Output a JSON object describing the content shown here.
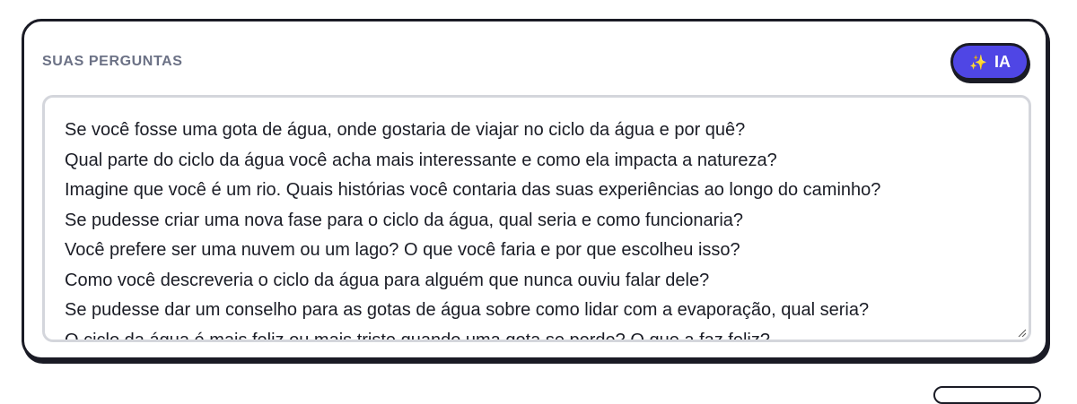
{
  "section": {
    "title": "SUAS PERGUNTAS"
  },
  "ai_button": {
    "icon": "sparkles-icon",
    "label": "IA",
    "color": "#4f46e5"
  },
  "questions": [
    "Se você fosse uma gota de água, onde gostaria de viajar no ciclo da água e por quê?",
    "Qual parte do ciclo da água você acha mais interessante e como ela impacta a natureza?",
    "Imagine que você é um rio. Quais histórias você contaria das suas experiências ao longo do caminho?",
    "Se pudesse criar uma nova fase para o ciclo da água, qual seria e como funcionaria?",
    "Você prefere ser uma nuvem ou um lago? O que você faria e por que escolheu isso?",
    "Como você descreveria o ciclo da água para alguém que nunca ouviu falar dele?",
    "Se pudesse dar um conselho para as gotas de água sobre como lidar com a evaporação, qual seria?",
    "O ciclo da água é mais feliz ou mais triste quando uma gota se perde? O que a faz feliz?"
  ]
}
